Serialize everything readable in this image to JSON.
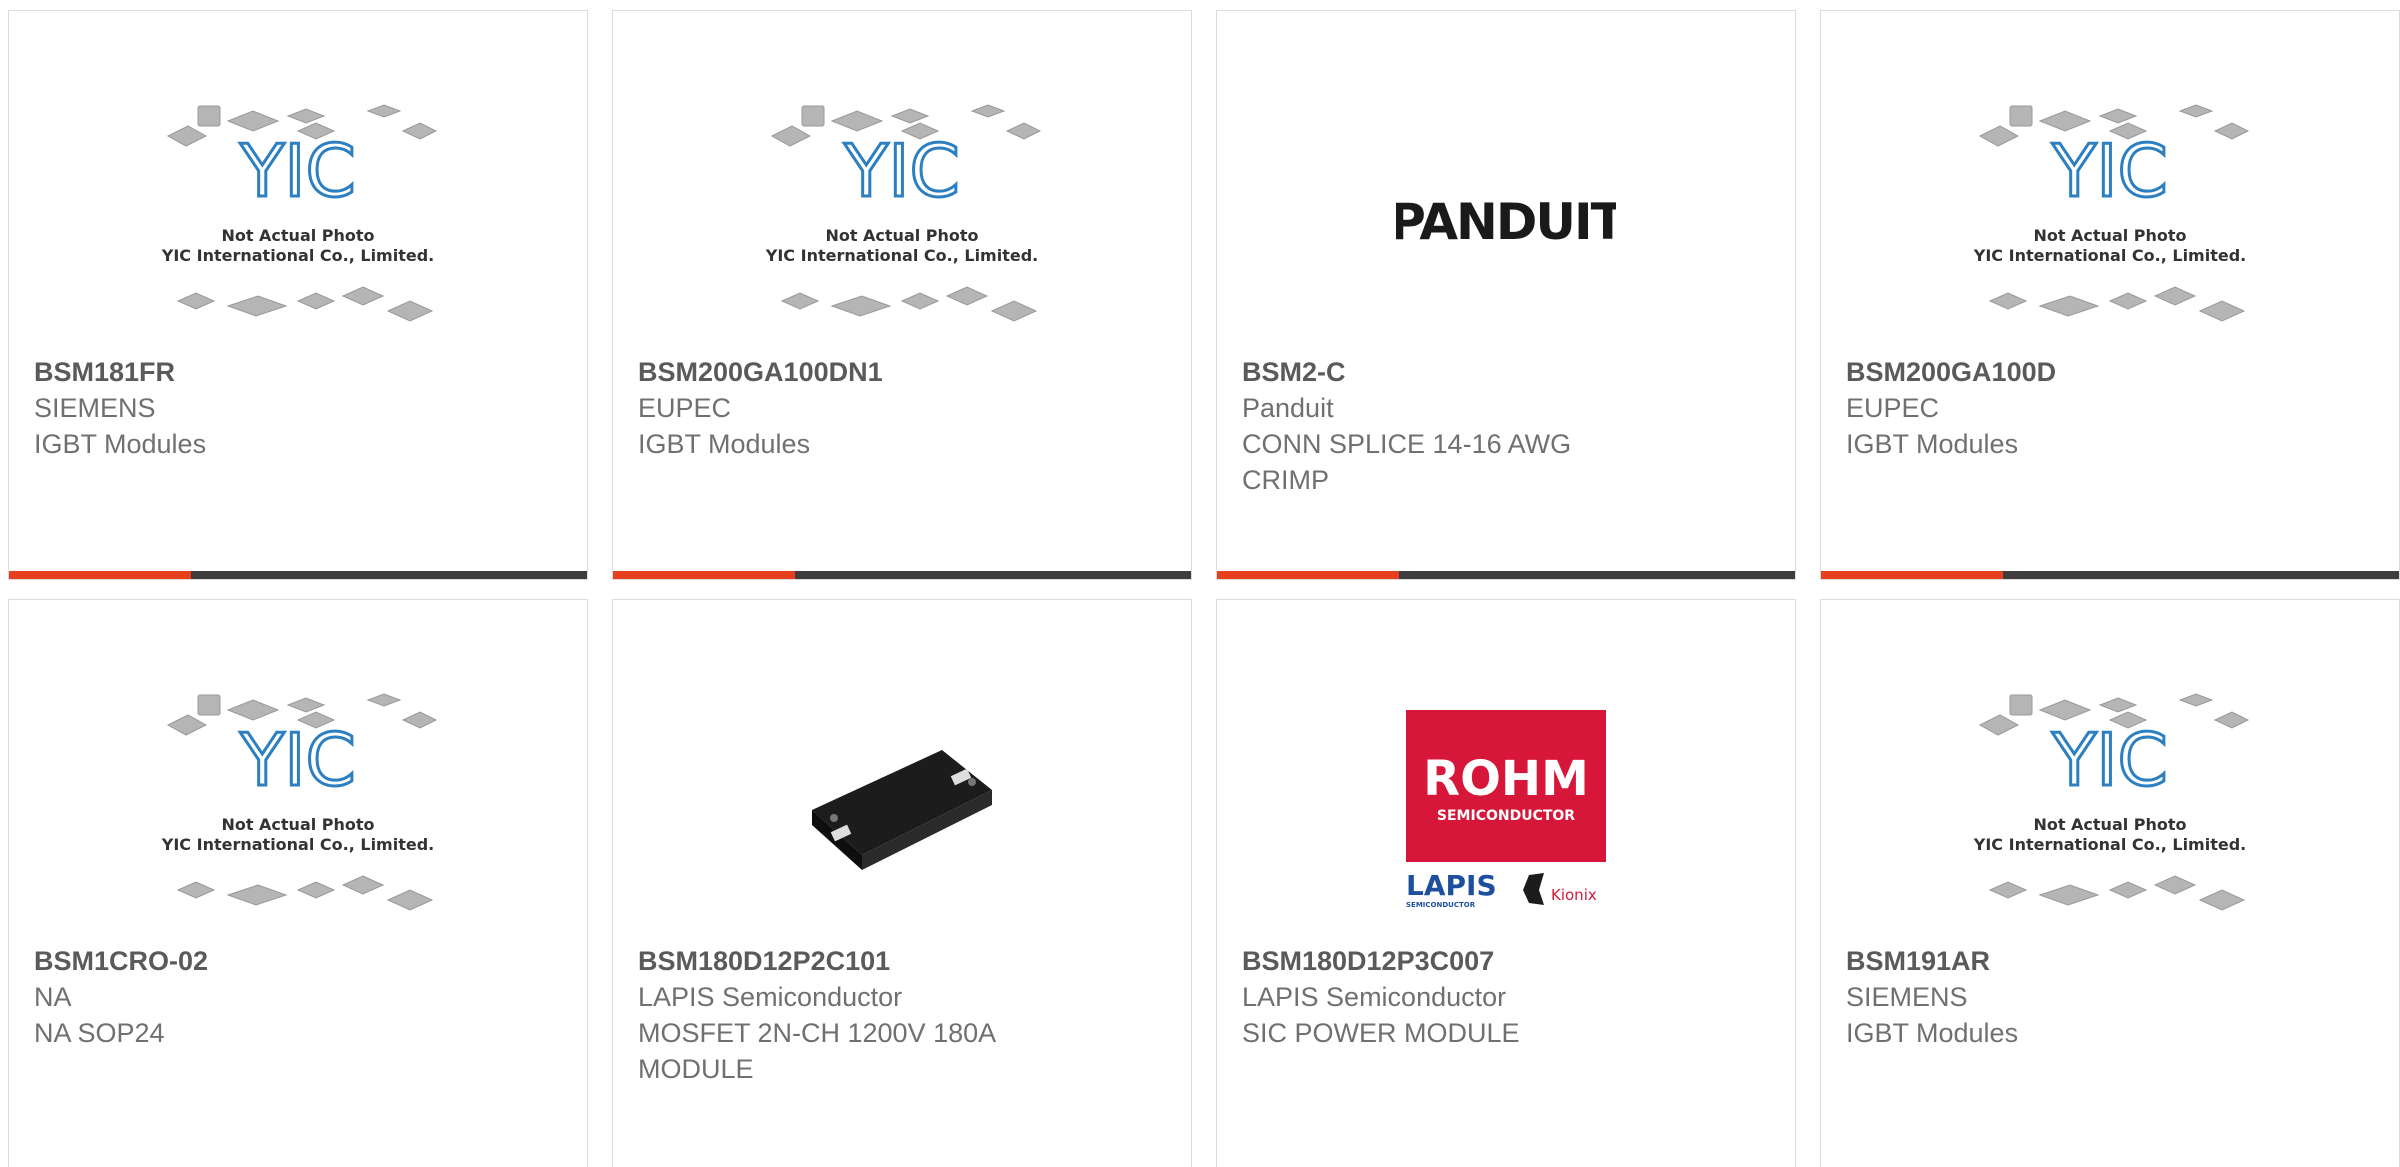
{
  "placeholder": {
    "logo_text": "YIC",
    "line1": "Not Actual Photo",
    "line2": "YIC International Co., Limited."
  },
  "products": [
    {
      "part": "BSM181FR",
      "maker": "SIEMENS",
      "desc": "IGBT Modules",
      "image": "placeholder"
    },
    {
      "part": "BSM200GA100DN1",
      "maker": "EUPEC",
      "desc": "IGBT Modules",
      "image": "placeholder"
    },
    {
      "part": "BSM2-C",
      "maker": "Panduit",
      "desc": "CONN SPLICE 14-16 AWG CRIMP",
      "image": "panduit-logo",
      "logo_text": "PANDUIT"
    },
    {
      "part": "BSM200GA100D",
      "maker": "EUPEC",
      "desc": "IGBT Modules",
      "image": "placeholder"
    },
    {
      "part": "BSM1CRO-02",
      "maker": "NA",
      "desc": "NA SOP24",
      "image": "placeholder"
    },
    {
      "part": "BSM180D12P2C101",
      "maker": "LAPIS Semiconductor",
      "desc": "MOSFET 2N-CH 1200V 180A MODULE",
      "image": "module-photo"
    },
    {
      "part": "BSM180D12P3C007",
      "maker": "LAPIS Semiconductor",
      "desc": "SIC POWER MODULE",
      "image": "rohm-logo",
      "logo_texts": {
        "rohm": "ROHM",
        "semi": "SEMICONDUCTOR",
        "lapis": "LAPIS",
        "lapis_sub": "SEMICONDUCTOR",
        "kionix": "Kionix"
      }
    },
    {
      "part": "BSM191AR",
      "maker": "SIEMENS",
      "desc": "IGBT Modules",
      "image": "placeholder"
    }
  ],
  "colors": {
    "accent": "#e8401c",
    "bar": "#3d3d3d",
    "text": "#707070",
    "yic_blue": "#2c7fc1",
    "rohm_red": "#d7173a"
  }
}
